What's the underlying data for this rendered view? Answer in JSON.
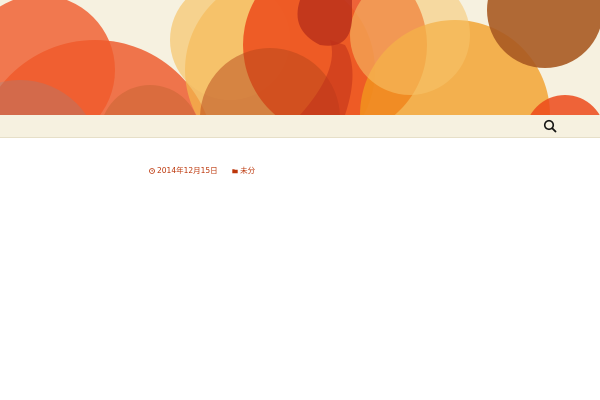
{
  "header": {
    "site_title": "",
    "colors": {
      "background": "#f6f1e0",
      "circle_red": "#ec4a1a",
      "circle_orange": "#f29a1e",
      "circle_yellow": "#f6c56b",
      "circle_brown": "#a85a22"
    }
  },
  "navbar": {
    "search_icon": "search-icon"
  },
  "post": {
    "title": "",
    "date": "2014年12月15日",
    "category": "未分",
    "date_icon": "clock-icon",
    "category_icon": "folder-icon",
    "accent_color": "#bc360a",
    "paragraphs": [
      [
        "",
        ""
      ],
      [
        "",
        "",
        "",
        ""
      ],
      [
        "",
        "",
        ""
      ],
      [
        "",
        "",
        ""
      ]
    ]
  }
}
